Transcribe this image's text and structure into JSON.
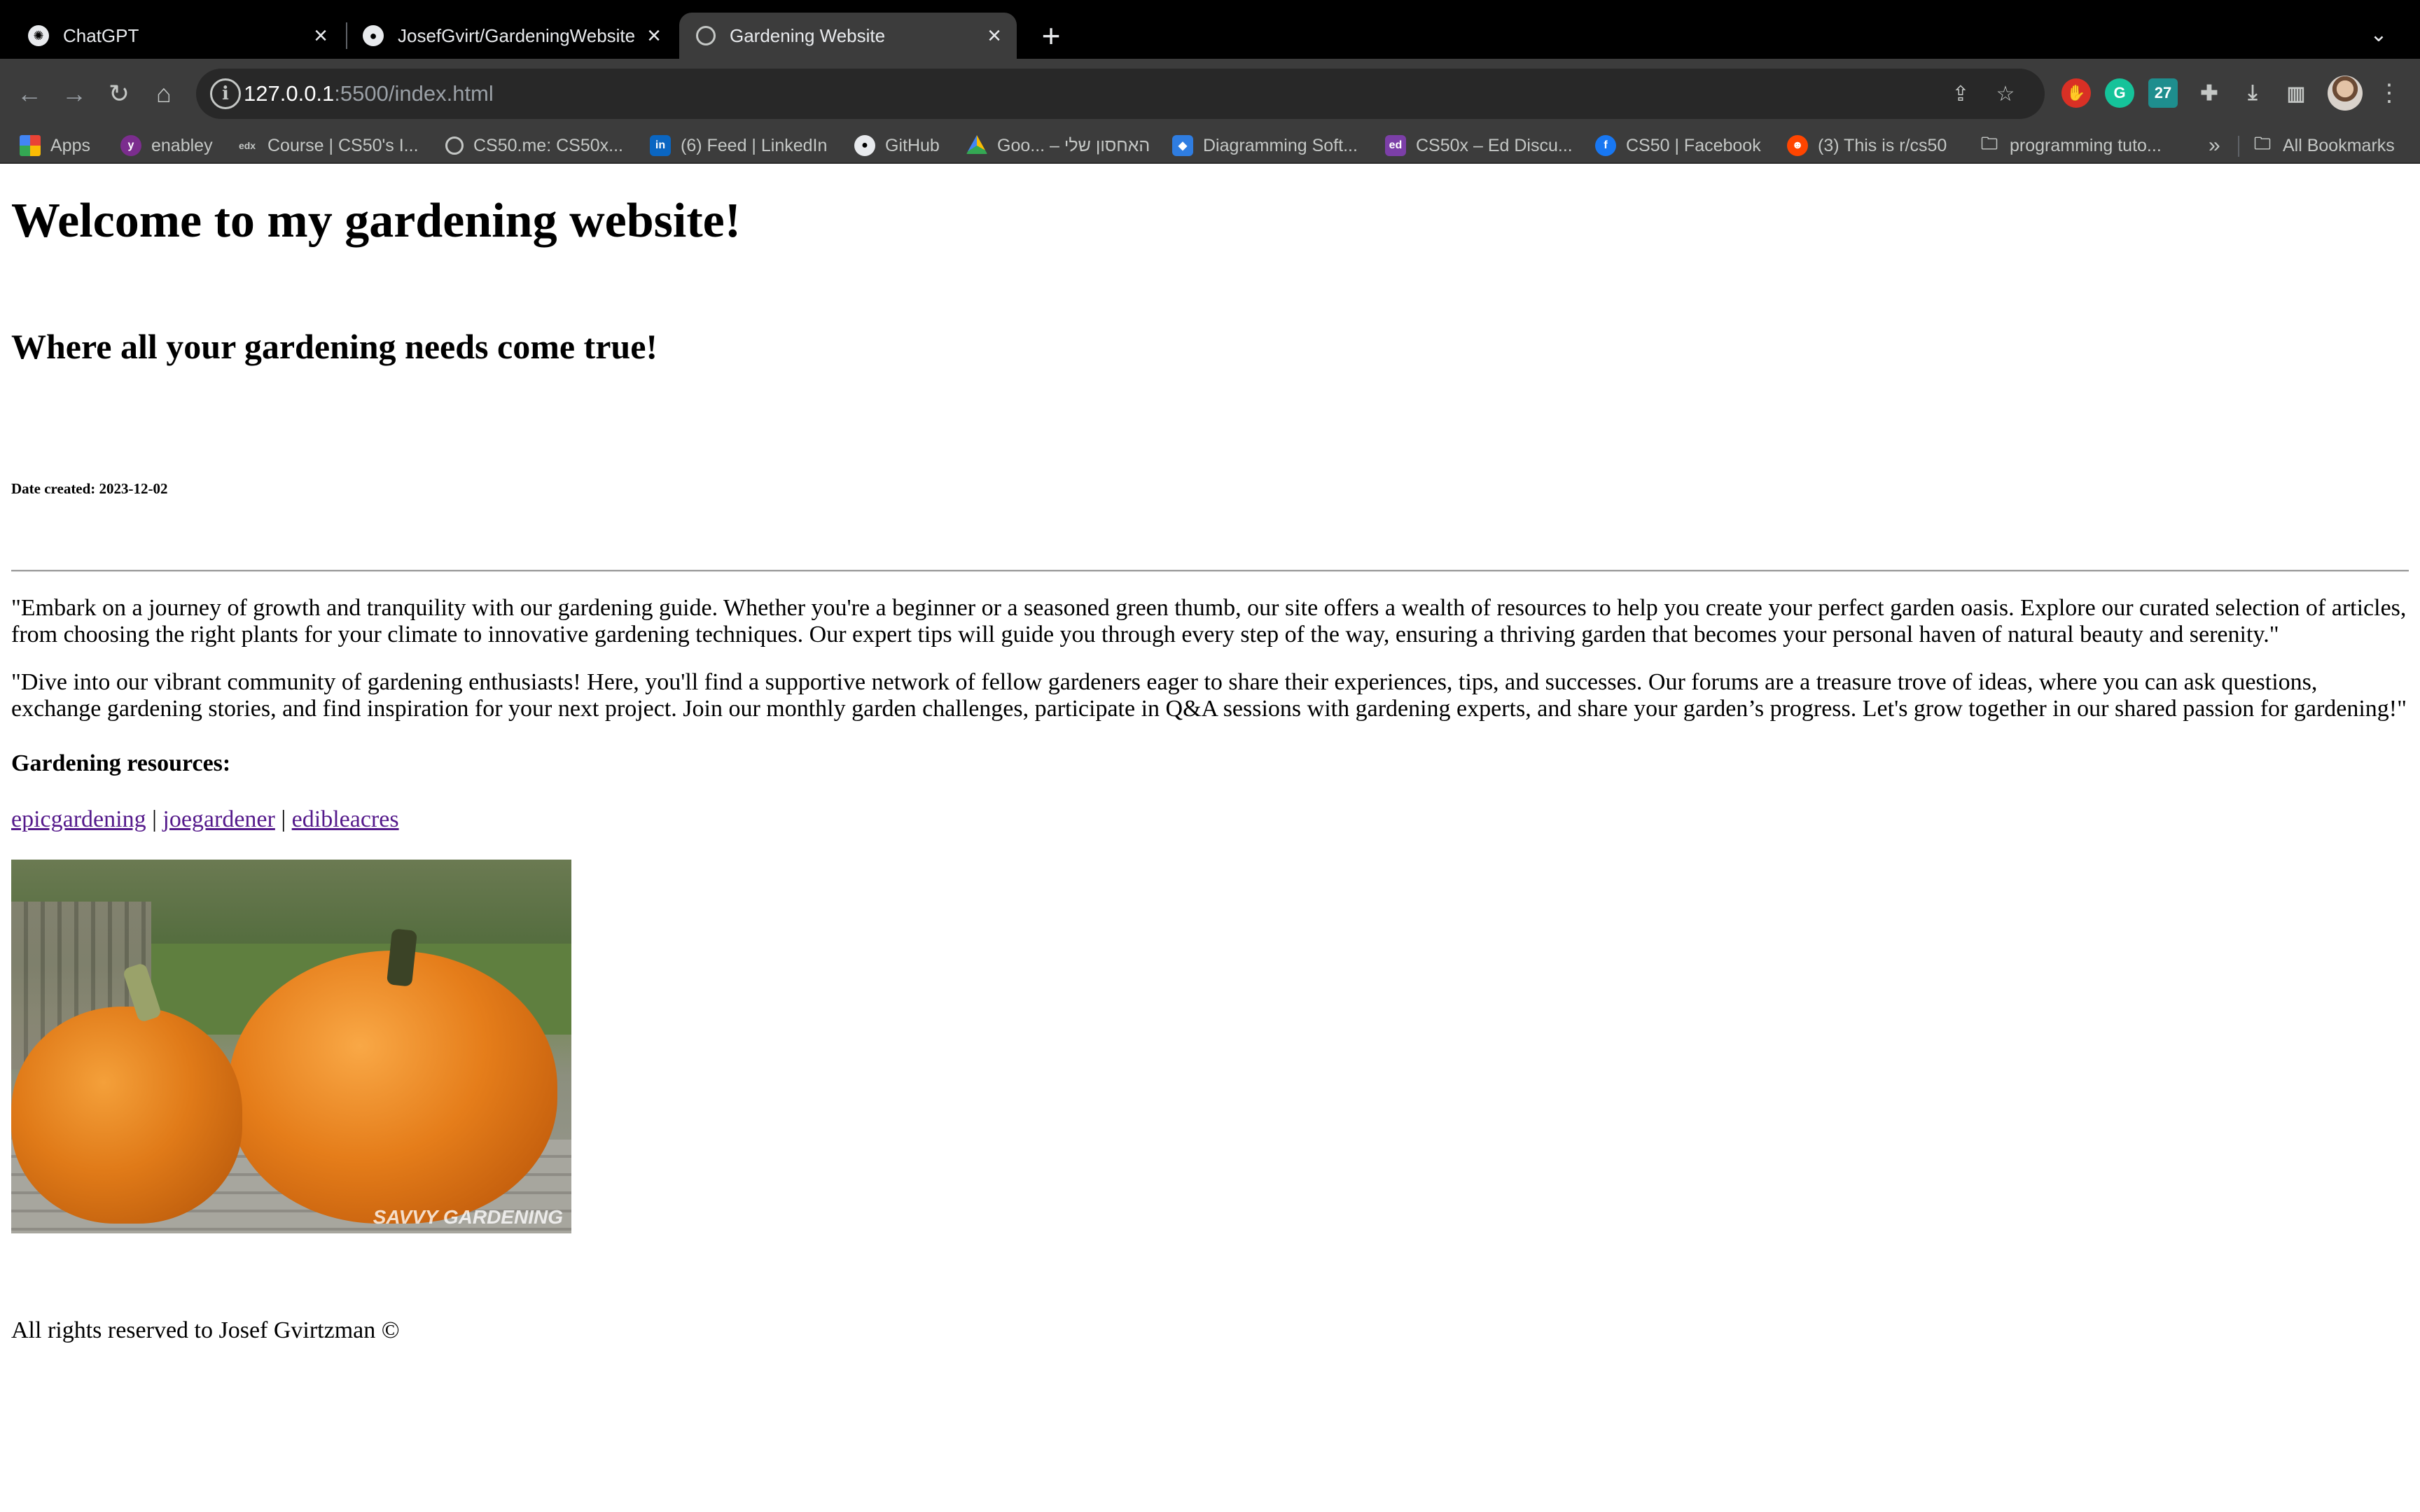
{
  "browser": {
    "tabs": [
      {
        "title": "ChatGPT",
        "icon": "chatgpt-icon",
        "active": false
      },
      {
        "title": "JosefGvirt/GardeningWebsite",
        "icon": "github-icon",
        "active": false
      },
      {
        "title": "Gardening Website",
        "icon": "globe-icon",
        "active": true
      }
    ],
    "url": {
      "host": "127.0.0.1",
      "path": ":5500/index.html"
    },
    "bookmarks": [
      {
        "label": "Apps",
        "icon": "apps-grid-icon",
        "color": "#ea4335"
      },
      {
        "label": "enabley",
        "icon": "enabley-icon",
        "color": "#7b2d8e"
      },
      {
        "label": "Course | CS50's I...",
        "icon": "edx-icon",
        "color": "#3c3c3c"
      },
      {
        "label": "CS50.me: CS50x...",
        "icon": "globe-icon",
        "color": "#3c3c3c"
      },
      {
        "label": "(6) Feed | LinkedIn",
        "icon": "linkedin-icon",
        "color": "#0a66c2"
      },
      {
        "label": "GitHub",
        "icon": "github-icon",
        "color": "#3c3c3c"
      },
      {
        "label": "Goo... – האחסון שלי",
        "icon": "google-drive-icon",
        "color": "#1fa463"
      },
      {
        "label": "Diagramming Soft...",
        "icon": "diagrams-icon",
        "color": "#2f7de1"
      },
      {
        "label": "CS50x – Ed Discu...",
        "icon": "ed-icon",
        "color": "#7c3fa8"
      },
      {
        "label": "CS50 | Facebook",
        "icon": "facebook-icon",
        "color": "#1877f2"
      },
      {
        "label": "(3) This is r/cs50",
        "icon": "reddit-icon",
        "color": "#ff4500"
      },
      {
        "label": "programming tuto...",
        "icon": "folder-icon",
        "color": "#3c3c3c"
      }
    ],
    "more_bookmarks": "»",
    "all_bookmarks": "All Bookmarks"
  },
  "page": {
    "heading": "Welcome to my gardening website!",
    "subheading": "Where all your gardening needs come true!",
    "date_created": "Date created: 2023-12-02",
    "paragraphs": [
      "\"Embark on a journey of growth and tranquility with our gardening guide. Whether you're a beginner or a seasoned green thumb, our site offers a wealth of resources to help you create your perfect garden oasis. Explore our curated selection of articles, from choosing the right plants for your climate to innovative gardening techniques. Our expert tips will guide you through every step of the way, ensuring a thriving garden that becomes your personal haven of natural beauty and serenity.\"",
      "\"Dive into our vibrant community of gardening enthusiasts! Here, you'll find a supportive network of fellow gardeners eager to share their experiences, tips, and successes. Our forums are a treasure trove of ideas, where you can ask questions, exchange gardening stories, and find inspiration for your next project. Join our monthly garden challenges, participate in Q&A sessions with gardening experts, and share your garden’s progress. Let's grow together in our shared passion for gardening!\""
    ],
    "resources_title": "Gardening resources:",
    "links": [
      "epicgardening",
      "joegardener",
      "edibleacres"
    ],
    "link_separator": "|",
    "image_watermark": "SAVVY GARDENING",
    "footer": "All rights reserved to Josef Gvirtzman ©"
  }
}
